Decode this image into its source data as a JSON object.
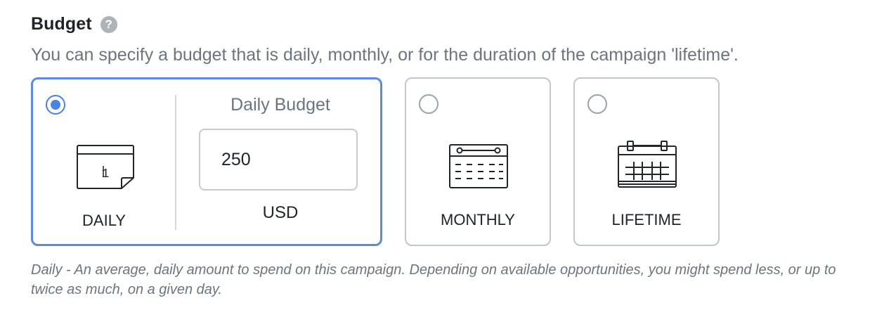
{
  "section": {
    "title": "Budget",
    "help_glyph": "?",
    "description": "You can specify a budget that is daily, monthly, or for the duration of the campaign 'lifetime'."
  },
  "options": {
    "daily": {
      "label": "DAILY",
      "selected": true,
      "icon": "calendar-day-icon",
      "icon_text": "1",
      "budget_title": "Daily Budget",
      "budget_value": "250",
      "currency": "USD"
    },
    "monthly": {
      "label": "MONTHLY",
      "selected": false,
      "icon": "calendar-month-icon"
    },
    "lifetime": {
      "label": "LIFETIME",
      "selected": false,
      "icon": "calendar-lifetime-icon"
    }
  },
  "footnote": "Daily - An average, daily amount to spend on this campaign. Depending on available opportunities, you might spend less, or up to twice as much, on a given day.",
  "colors": {
    "accent": "#4c82e4",
    "selected_border": "#5b8be0",
    "muted_text": "#6c757d"
  }
}
